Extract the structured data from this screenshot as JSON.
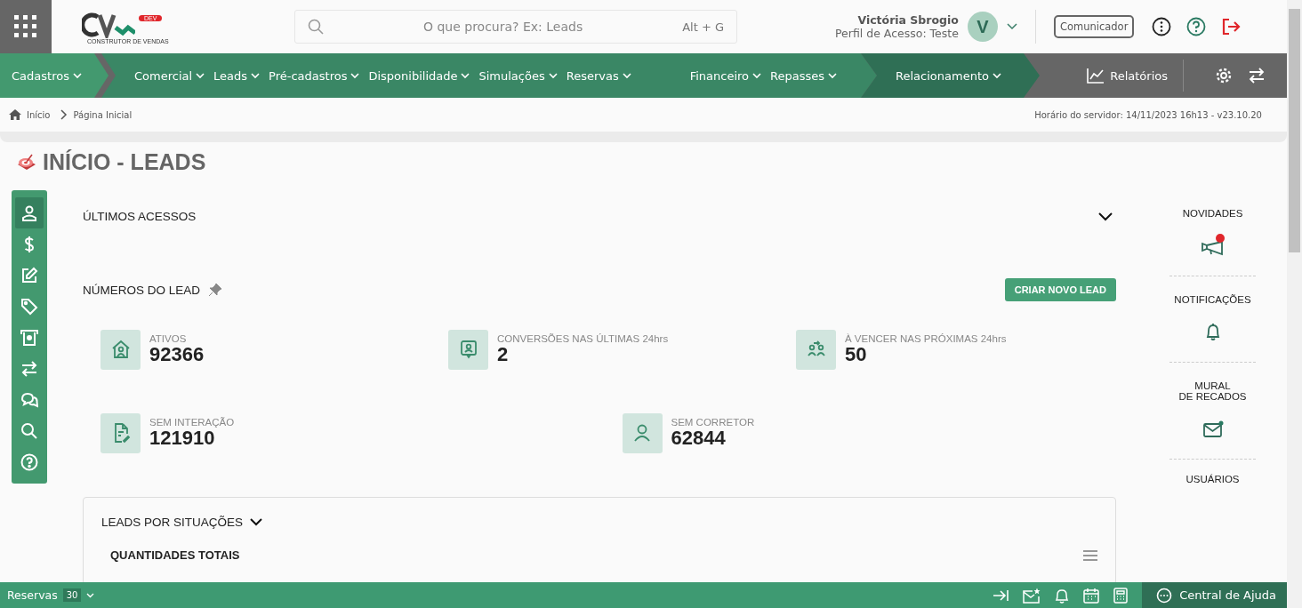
{
  "header": {
    "logo_tag": "DEV",
    "logo_caption": "CONSTRUTOR DE VENDAS",
    "search": {
      "placeholder": "O que procura? Ex: Leads",
      "shortcut": "Alt + G"
    },
    "user": {
      "name": "Victória Sbrogio",
      "profile": "Perfil de Acesso: Teste",
      "initial": "V"
    },
    "communicator": "Comunicador"
  },
  "nav": {
    "groups": [
      {
        "items": [
          "Cadastros"
        ]
      },
      {
        "items": [
          "Comercial",
          "Leads",
          "Pré-cadastros",
          "Disponibilidade",
          "Simulações",
          "Reservas",
          "Financeiro",
          "Repasses"
        ]
      },
      {
        "items": [
          "Relacionamento"
        ]
      }
    ],
    "reports": "Relatórios"
  },
  "breadcrumb": [
    "Início",
    "Página Inicial"
  ],
  "server_time": "Horário do servidor: 14/11/2023 16h13 - v23.10.20",
  "page_title": "INÍCIO - LEADS",
  "sidebar": {
    "items": [
      {
        "selected": true
      },
      {
        "selected": false
      },
      {
        "selected": false
      },
      {
        "selected": false
      },
      {
        "selected": false
      },
      {
        "selected": false
      },
      {
        "selected": false
      },
      {
        "selected": false
      },
      {
        "selected": false
      }
    ]
  },
  "last_access": {
    "title": "ÚLTIMOS ACESSOS",
    "expanded": false
  },
  "lead_numbers": {
    "title": "NÚMEROS DO LEAD",
    "create_button": "CRIAR NOVO LEAD",
    "rows": [
      [
        {
          "label": "ATIVOS",
          "value": "92366"
        },
        {
          "label": "CONVERSÕES NAS ÚLTIMAS 24hrs",
          "value": "2"
        },
        {
          "label": "À VENCER NAS PRÓXIMAS 24hrs",
          "value": "50"
        }
      ],
      [
        {
          "label": "SEM INTERAÇÃO",
          "value": "121910"
        },
        {
          "label": "SEM CORRETOR",
          "value": "62844"
        }
      ]
    ]
  },
  "situations": {
    "title": "LEADS POR SITUAÇÕES",
    "subtitle": "QUANTIDADES TOTAIS"
  },
  "right_panel": [
    {
      "title": "NOVIDADES",
      "badge": true
    },
    {
      "title": "NOTIFICAÇÕES",
      "badge": false
    },
    {
      "title": "MURAL\nDE RECADOS",
      "badge": true
    },
    {
      "title": "USUÁRIOS"
    }
  ],
  "bottom_bar": {
    "reservations": "Reservas",
    "count": "30",
    "help": "Central de Ajuda"
  }
}
